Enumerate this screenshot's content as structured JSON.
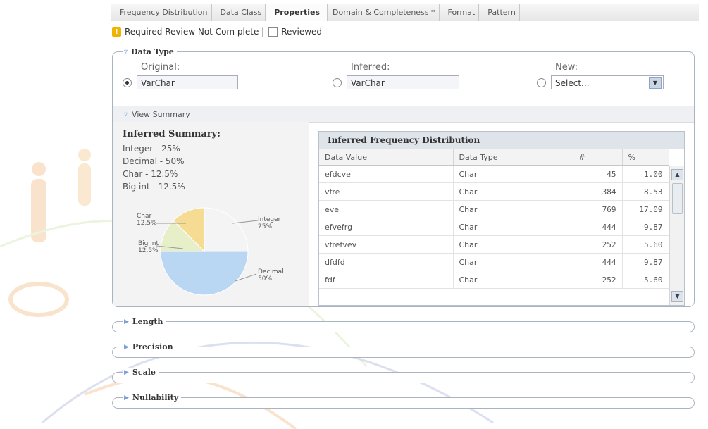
{
  "tabs": [
    {
      "label": "Frequency Distribution",
      "active": false
    },
    {
      "label": "Data Class",
      "active": false
    },
    {
      "label": "Properties",
      "active": true
    },
    {
      "label": "Domain & Completeness *",
      "active": false
    },
    {
      "label": "Format",
      "active": false
    },
    {
      "label": "Pattern",
      "active": false
    }
  ],
  "review": {
    "status_text": "Required Review Not Com plete |",
    "checkbox_label": "Reviewed"
  },
  "data_type": {
    "section_title": "Data Type",
    "original": {
      "label": "Original:",
      "value": "VarChar",
      "selected": true
    },
    "inferred": {
      "label": "Inferred:",
      "value": "VarChar",
      "selected": false
    },
    "new": {
      "label": "New:",
      "value": "Select...",
      "selected": false
    },
    "view_summary_label": "View Summary"
  },
  "inferred_summary": {
    "title": "Inferred Summary:",
    "lines": [
      "Integer - 25%",
      "Decimal - 50%",
      "Char - 12.5%",
      "Big int - 12.5%"
    ]
  },
  "chart_data": {
    "type": "pie",
    "slices": [
      {
        "label": "Integer",
        "value": 25,
        "color": "#f4f4f4"
      },
      {
        "label": "Decimal",
        "value": 50,
        "color": "#b9d6f2"
      },
      {
        "label": "Big int",
        "value": 12.5,
        "color": "#e6efc8"
      },
      {
        "label": "Char",
        "value": 12.5,
        "color": "#f5dc92"
      }
    ],
    "labels": {
      "char": [
        "Char",
        "12.5%"
      ],
      "integer": [
        "Integer",
        "25%"
      ],
      "bigint": [
        "Big int",
        "12.5%"
      ],
      "decimal": [
        "Decimal",
        "50%"
      ]
    }
  },
  "frequency": {
    "title": "Inferred Frequency Distribution",
    "columns": [
      "Data Value",
      "Data Type",
      "#",
      "%"
    ],
    "rows": [
      [
        "efdcve",
        "Char",
        "45",
        "1.00"
      ],
      [
        "vfre",
        "Char",
        "384",
        "8.53"
      ],
      [
        "eve",
        "Char",
        "769",
        "17.09"
      ],
      [
        "efvefrg",
        "Char",
        "444",
        "9.87"
      ],
      [
        "vfrefvev",
        "Char",
        "252",
        "5.60"
      ],
      [
        "dfdfd",
        "Char",
        "444",
        "9.87"
      ],
      [
        "fdf",
        "Char",
        "252",
        "5.60"
      ]
    ]
  },
  "collapsed_sections": [
    "Length",
    "Precision",
    "Scale",
    "Nullability"
  ],
  "icons": {
    "warning": "warning-icon",
    "section_toggle": "chevron-down-icon",
    "collapsed_toggle": "triangle-right-icon",
    "dropdown": "chevron-down-icon",
    "scroll_up": "arrow-up-icon",
    "scroll_down": "arrow-down-icon"
  },
  "colors": {
    "accent": "#7b9fd6",
    "warning": "#f0b400"
  }
}
